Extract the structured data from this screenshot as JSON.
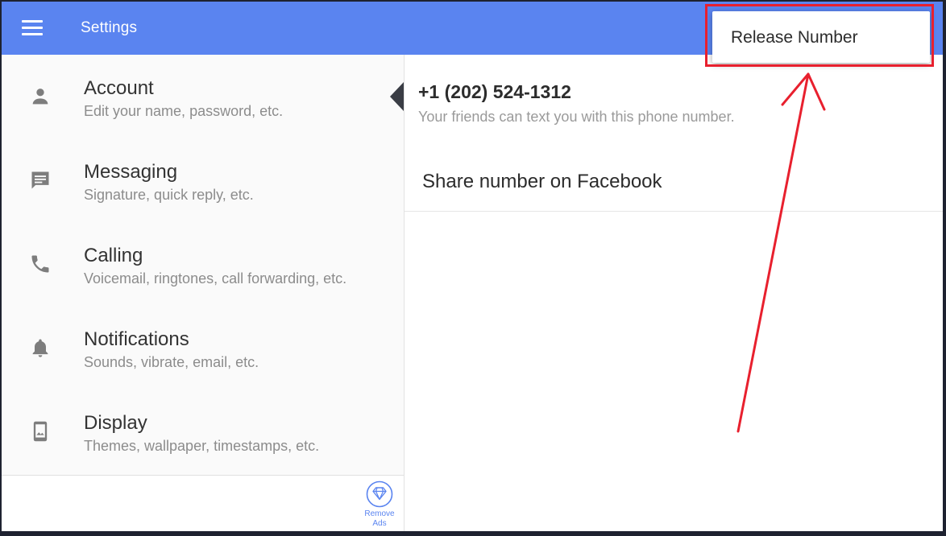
{
  "appbar": {
    "title": "Settings",
    "menu_icon": "hamburger-menu-icon",
    "color": "#5a84f0"
  },
  "sidebar": {
    "items": [
      {
        "title": "Account",
        "subtitle": "Edit your name, password, etc.",
        "icon": "person-icon"
      },
      {
        "title": "Messaging",
        "subtitle": "Signature, quick reply, etc.",
        "icon": "chat-bubble-icon"
      },
      {
        "title": "Calling",
        "subtitle": "Voicemail, ringtones, call forwarding, etc.",
        "icon": "phone-icon"
      },
      {
        "title": "Notifications",
        "subtitle": "Sounds, vibrate, email, etc.",
        "icon": "bell-icon"
      },
      {
        "title": "Display",
        "subtitle": "Themes, wallpaper, timestamps, etc.",
        "icon": "phone-wallpaper-icon"
      }
    ],
    "footer": {
      "remove_ads_label": "Remove Ads",
      "icon": "diamond-icon"
    }
  },
  "detail": {
    "phone_number": "+1 (202) 524-1312",
    "phone_subtitle": "Your friends can text you with this phone number.",
    "share_label": "Share number on Facebook"
  },
  "popup_menu": {
    "items": [
      {
        "label": "Release Number"
      }
    ]
  },
  "annotation": {
    "color": "#e8202e"
  }
}
